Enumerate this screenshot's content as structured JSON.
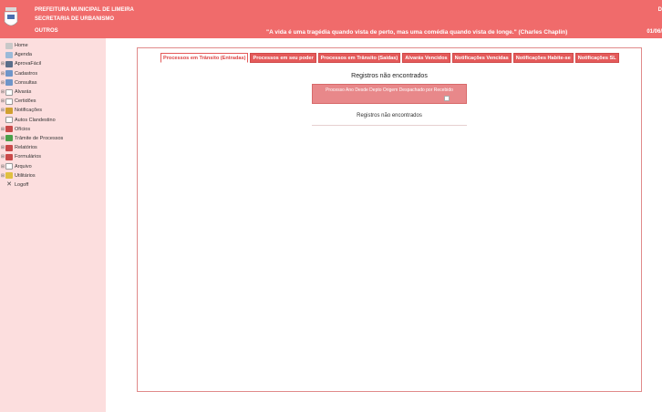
{
  "header": {
    "line1": "PREFEITURA MUNICIPAL DE LIMEIRA",
    "line2": "SECRETARIA DE URBANISMO",
    "line3": "OUTROS",
    "right_top": "D",
    "quote": "\"A vida é uma tragédia quando vista de perto, mas uma comédia quando vista de longe.\" (Charles Chaplin)",
    "date": "01/06/"
  },
  "sidebar": {
    "items": [
      {
        "label": "Home",
        "icon": "home-icon",
        "expandable": false
      },
      {
        "label": "Agenda",
        "icon": "agenda-icon",
        "expandable": false
      },
      {
        "label": "AprovaFácil",
        "icon": "aprova-icon",
        "expandable": true
      },
      {
        "label": "Cadastros",
        "icon": "list-icon",
        "expandable": true
      },
      {
        "label": "Consultas",
        "icon": "list-icon",
        "expandable": true
      },
      {
        "label": "Alvarás",
        "icon": "document-icon",
        "expandable": true
      },
      {
        "label": "Certidões",
        "icon": "document-icon",
        "expandable": true
      },
      {
        "label": "Notificações",
        "icon": "pen-icon",
        "expandable": true
      },
      {
        "label": "Autos Clandestino",
        "icon": "document-icon",
        "expandable": false
      },
      {
        "label": "Ofícios",
        "icon": "folder-icon",
        "expandable": true
      },
      {
        "label": "Trâmite de Processos",
        "icon": "globe-icon",
        "expandable": true
      },
      {
        "label": "Relatórios",
        "icon": "folder-icon",
        "expandable": true
      },
      {
        "label": "Formulários",
        "icon": "folder-icon",
        "expandable": true
      },
      {
        "label": "Arquivo",
        "icon": "document-icon",
        "expandable": true
      },
      {
        "label": "Utilitários",
        "icon": "bulb-icon",
        "expandable": true
      },
      {
        "label": "Logoff",
        "icon": "logoff-icon",
        "expandable": false
      }
    ]
  },
  "tabs": [
    {
      "label": "Processos em Trânsito (Entradas)",
      "active": true
    },
    {
      "label": "Processos em seu poder",
      "active": false
    },
    {
      "label": "Processos em Trânsito (Saídas)",
      "active": false
    },
    {
      "label": "Alvarás Vencidos",
      "active": false
    },
    {
      "label": "Notificações Vencidas",
      "active": false
    },
    {
      "label": "Notificações Habite-se",
      "active": false
    },
    {
      "label": "Notificações SL",
      "active": false
    }
  ],
  "content": {
    "title": "Registros não encontrados",
    "process_header": "Processo Ano Desde Depto Origem Despachado por Recebido",
    "empty": "Registros não encontrados"
  },
  "colors": {
    "header_bg": "#f06b6b",
    "sidebar_bg": "#fcdede",
    "tab_bg": "#e45a5a"
  }
}
